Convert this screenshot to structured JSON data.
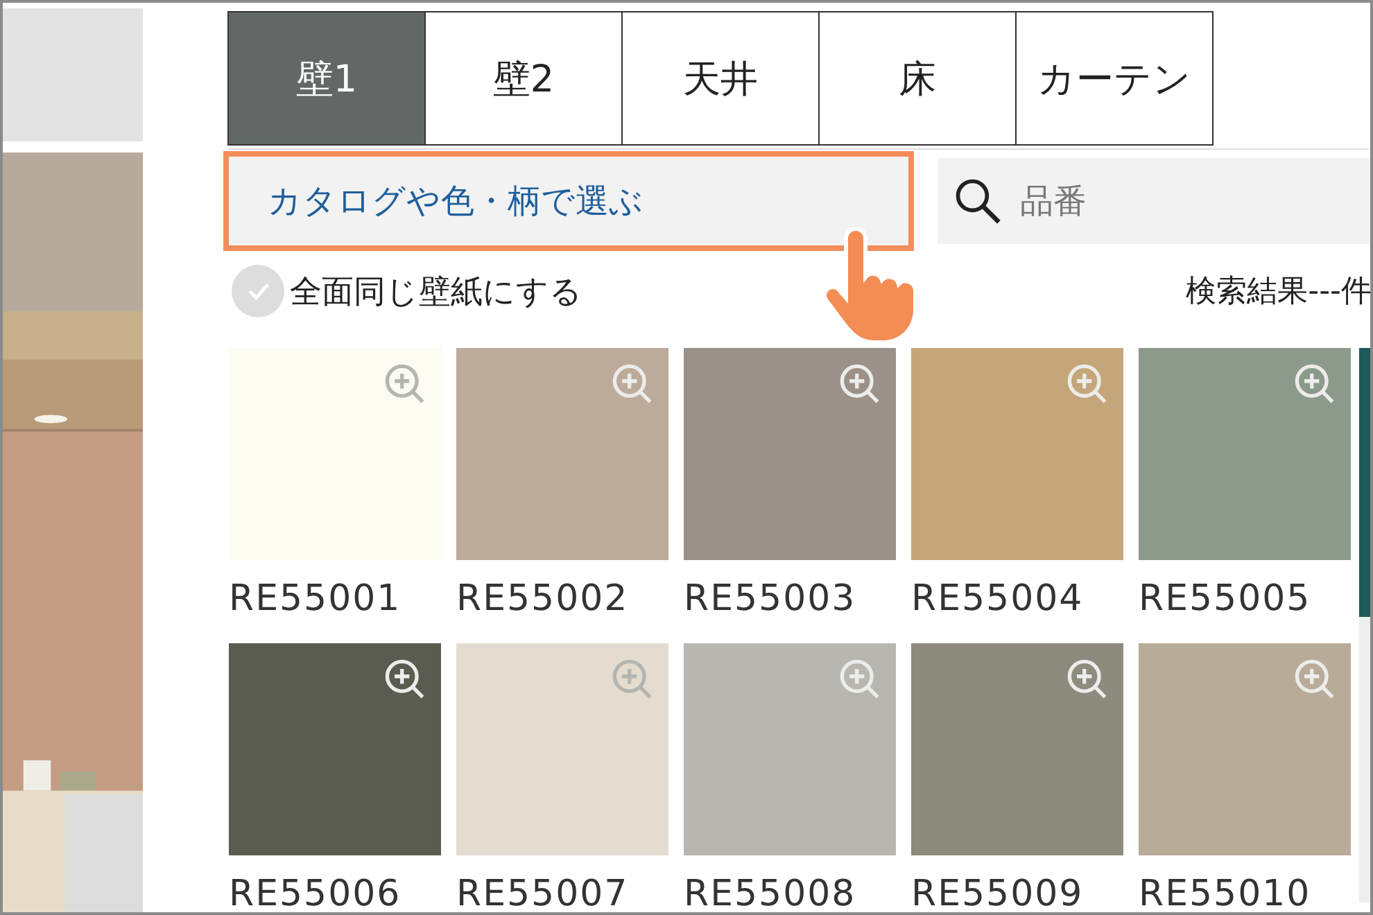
{
  "tabs": [
    {
      "label": "壁1",
      "selected": true
    },
    {
      "label": "壁2",
      "selected": false
    },
    {
      "label": "天井",
      "selected": false
    },
    {
      "label": "床",
      "selected": false
    },
    {
      "label": "カーテン",
      "selected": false
    }
  ],
  "catalog_button": {
    "label": "カタログや色・柄で選ぶ"
  },
  "search": {
    "placeholder": "品番"
  },
  "same_wallpaper": {
    "label": "全面同じ壁紙にする",
    "checked": false
  },
  "result_count": "検索結果---件",
  "swatches": [
    {
      "code": "RE55001",
      "color": "#fbfbf1"
    },
    {
      "code": "RE55002",
      "color": "#bcab9b"
    },
    {
      "code": "RE55003",
      "color": "#9c9189"
    },
    {
      "code": "RE55004",
      "color": "#c4a67a"
    },
    {
      "code": "RE55005",
      "color": "#8c9a8b"
    },
    {
      "code": "RE55006",
      "color": "#5a5c50"
    },
    {
      "code": "RE55007",
      "color": "#e3dccf"
    },
    {
      "code": "RE55008",
      "color": "#b7b6b1"
    },
    {
      "code": "RE55009",
      "color": "#8d8b7e"
    },
    {
      "code": "RE55010",
      "color": "#b8ab98"
    }
  ]
}
